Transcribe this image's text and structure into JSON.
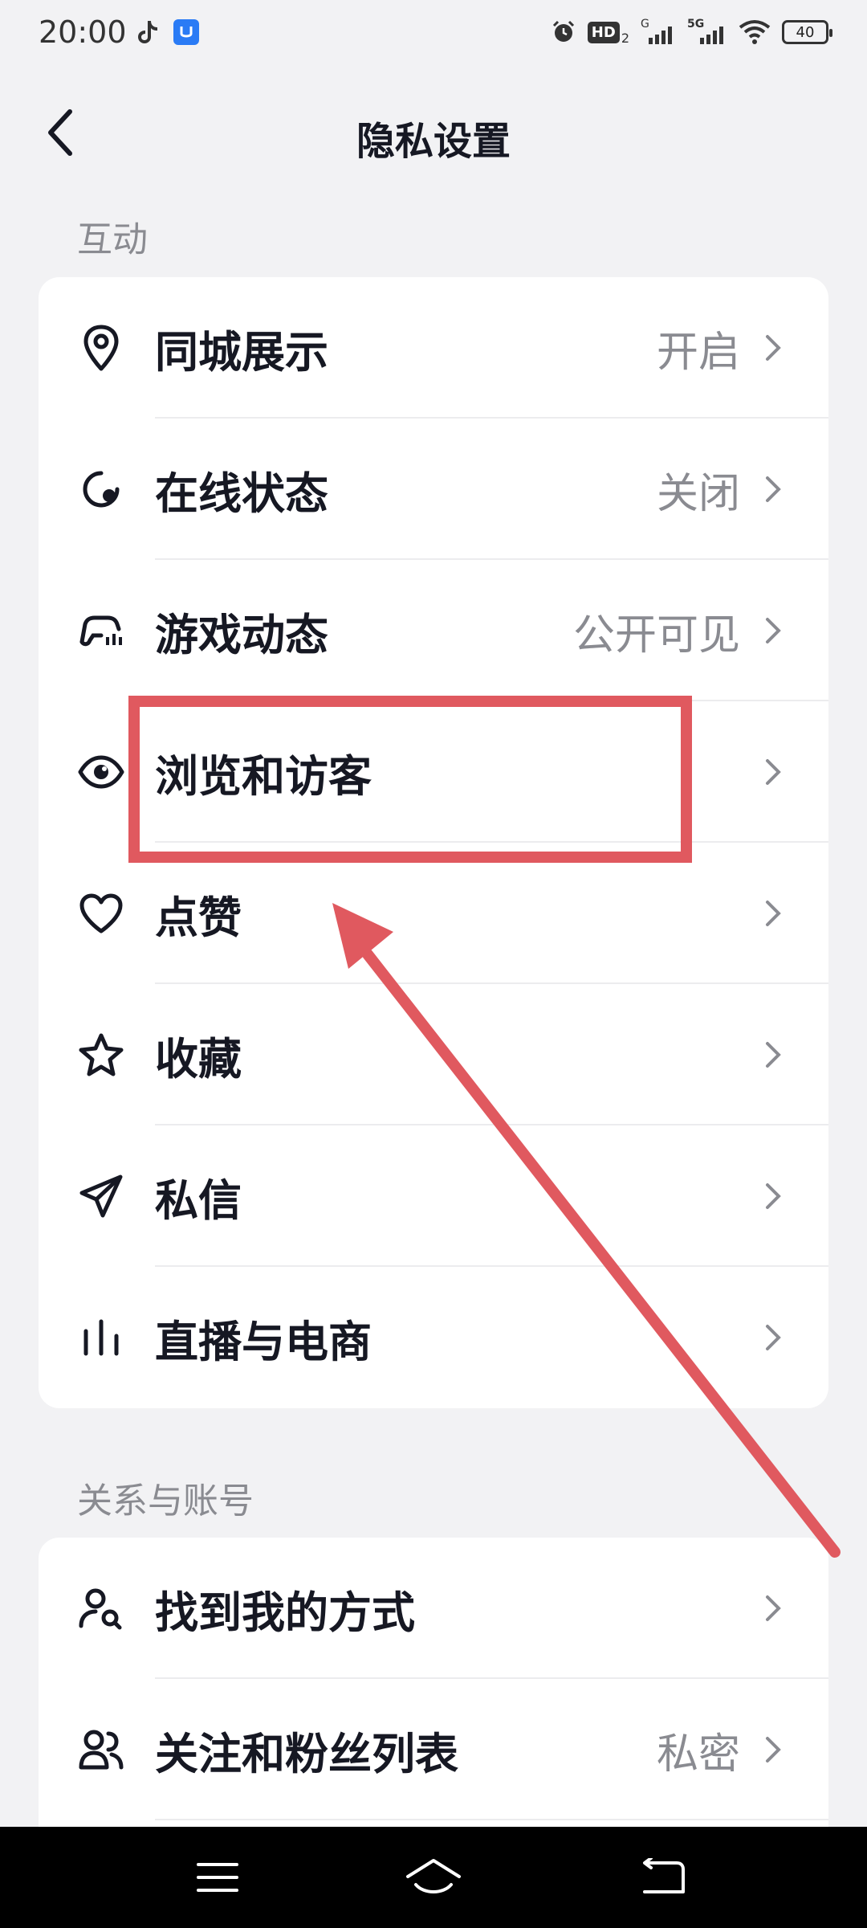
{
  "status_bar": {
    "time": "20:00",
    "battery": "40",
    "icons": [
      "tiktok-icon",
      "app-badge-icon",
      "alarm-icon",
      "hd-icon",
      "signal-icon",
      "5g-signal-icon",
      "wifi-icon",
      "battery-icon"
    ],
    "hd_label": "HD",
    "network_g": "G",
    "network_5g": "5G"
  },
  "header": {
    "title": "隐私设置",
    "back_icon": "chevron-left-icon"
  },
  "section_interaction": {
    "title": "互动",
    "items": [
      {
        "label": "同城展示",
        "value": "开启",
        "icon": "location-pin-icon"
      },
      {
        "label": "在线状态",
        "value": "关闭",
        "icon": "online-status-icon"
      },
      {
        "label": "游戏动态",
        "value": "公开可见",
        "icon": "game-controller-icon"
      },
      {
        "label": "浏览和访客",
        "value": "",
        "icon": "eye-icon"
      },
      {
        "label": "点赞",
        "value": "",
        "icon": "heart-icon"
      },
      {
        "label": "收藏",
        "value": "",
        "icon": "star-icon"
      },
      {
        "label": "私信",
        "value": "",
        "icon": "paper-plane-icon"
      },
      {
        "label": "直播与电商",
        "value": "",
        "icon": "bar-chart-icon"
      }
    ]
  },
  "section_account": {
    "title": "关系与账号",
    "items": [
      {
        "label": "找到我的方式",
        "value": "",
        "icon": "user-search-icon"
      },
      {
        "label": "关注和粉丝列表",
        "value": "私密",
        "icon": "users-icon"
      }
    ]
  },
  "colors": {
    "background": "#f2f2f4",
    "card": "#ffffff",
    "text_primary": "#161823",
    "text_secondary": "#8a8b91",
    "annotation": "#e0595f"
  }
}
